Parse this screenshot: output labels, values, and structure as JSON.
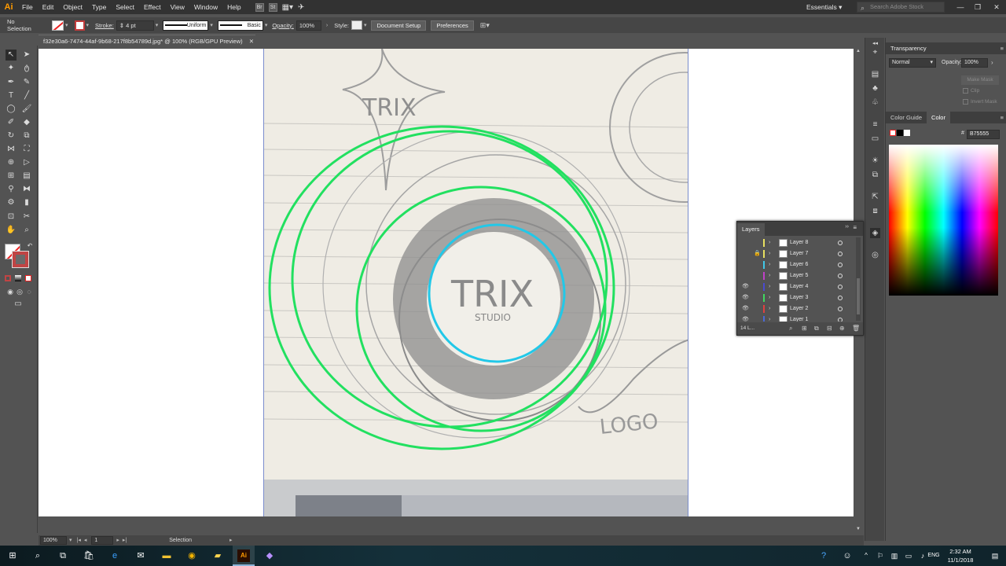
{
  "app": {
    "logo": "Ai"
  },
  "menu": [
    "File",
    "Edit",
    "Object",
    "Type",
    "Select",
    "Effect",
    "View",
    "Window",
    "Help"
  ],
  "menubar_icons": {
    "br": "Br",
    "st": "St"
  },
  "workspace": "Essentials",
  "search": {
    "placeholder": "Search Adobe Stock"
  },
  "control": {
    "selection": "No Selection",
    "stroke_label": "Stroke:",
    "stroke_value": "4 pt",
    "stroke_profile": "Uniform",
    "brush": "Basic",
    "opacity_label": "Opacity:",
    "opacity_value": "100%",
    "style_label": "Style:",
    "doc_setup": "Document Setup",
    "preferences": "Preferences"
  },
  "document": {
    "tab_title": "f32e30a6-7474-44af-9b68-217f8b54789d.jpg* @ 100% (RGB/GPU Preview)"
  },
  "status": {
    "zoom": "100%",
    "artboard": "1",
    "tool": "Selection"
  },
  "transparency": {
    "title": "Transparency",
    "blend": "Normal",
    "opacity_label": "Opacity:",
    "opacity_value": "100%",
    "make_mask": "Make Mask",
    "clip": "Clip",
    "invert_mask": "Invert Mask"
  },
  "color": {
    "tab_guide": "Color Guide",
    "tab_color": "Color",
    "hex_prefix": "#",
    "hex": "B75555"
  },
  "layers": {
    "title": "Layers",
    "count": "14 L...",
    "items": [
      {
        "name": "Layer 8",
        "color": "#e8e060",
        "visible": false,
        "locked": false
      },
      {
        "name": "Layer 7",
        "color": "#e8e060",
        "visible": false,
        "locked": true
      },
      {
        "name": "Layer 6",
        "color": "#40c8e8",
        "visible": false,
        "locked": false
      },
      {
        "name": "Layer 5",
        "color": "#c040c8",
        "visible": false,
        "locked": false
      },
      {
        "name": "Layer 4",
        "color": "#4a4ad0",
        "visible": true,
        "locked": false
      },
      {
        "name": "Layer 3",
        "color": "#40d860",
        "visible": true,
        "locked": false
      },
      {
        "name": "Layer 2",
        "color": "#e04040",
        "visible": true,
        "locked": false
      },
      {
        "name": "Layer 1",
        "color": "#4a6ad8",
        "visible": true,
        "locked": false
      }
    ]
  },
  "sketch": {
    "title": "TRIX",
    "subtitle": "STUDIO",
    "note": "LOGO"
  },
  "taskbar": {
    "time": "2:32 AM",
    "date": "11/1/2018",
    "lang": "ENG"
  },
  "colors": {
    "accent_green": "#22e060",
    "accent_cyan": "#22c8e8",
    "stroke_red": "#c04444"
  }
}
